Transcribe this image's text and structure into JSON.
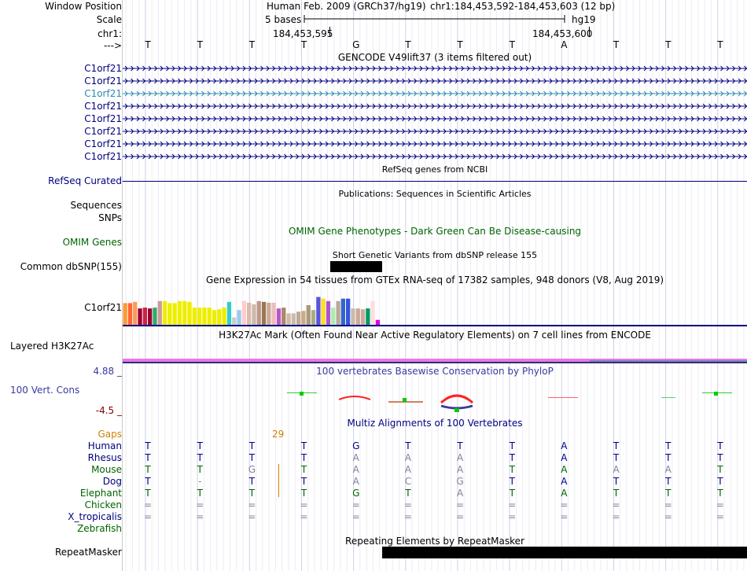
{
  "labels": {
    "window_position": "Window Position",
    "scale": "Scale",
    "chrom": "chr1:",
    "arrow": "--->",
    "gencode_items": [
      "C1orf21",
      "C1orf21",
      "C1orf21",
      "C1orf21",
      "C1orf21",
      "C1orf21",
      "C1orf21",
      "C1orf21"
    ],
    "refseq": "RefSeq Curated",
    "sequences": "Sequences",
    "snps": "SNPs",
    "omim": "OMIM Genes",
    "dbsnp": "Common dbSNP(155)",
    "gtex_gene": "C1orf21",
    "h3k27ac": "Layered H3K27Ac",
    "phylop_max": "4.88 _",
    "phylop_label": "100 Vert. Cons",
    "phylop_min": "-4.5 _",
    "gaps": "Gaps",
    "species": [
      "Human",
      "Rhesus",
      "Mouse",
      "Dog",
      "Elephant",
      "Chicken",
      "X_tropicalis",
      "Zebrafish"
    ],
    "repeatmasker": "RepeatMasker"
  },
  "header": {
    "assembly": "Human Feb. 2009 (GRCh37/hg19)",
    "position": "chr1:184,453,592-184,453,603 (12 bp)",
    "scale_text": "5 bases",
    "db": "hg19",
    "coord1": "184,453,595",
    "coord2": "184,453,600"
  },
  "sequence": [
    "T",
    "T",
    "T",
    "T",
    "G",
    "T",
    "T",
    "T",
    "A",
    "T",
    "T",
    "T"
  ],
  "track_titles": {
    "gencode": "GENCODE V49lift37 (3 items filtered out)",
    "refseq": "RefSeq genes from NCBI",
    "publications": "Publications: Sequences in Scientific Articles",
    "omim": "OMIM Gene Phenotypes - Dark Green Can Be Disease-causing",
    "dbsnp": "Short Genetic Variants from dbSNP release 155",
    "gtex": "Gene Expression in 54 tissues from GTEx RNA-seq of 17382 samples, 948 donors (V8, Aug 2019)",
    "h3k27ac": "H3K27Ac Mark (Often Found Near Active Regulatory Elements) on 7 cell lines from ENCODE",
    "phylop": "100 vertebrates Basewise Conservation by PhyloP",
    "multiz": "Multiz Alignments of 100 Vertebrates",
    "repeatmasker": "Repeating Elements by RepeatMasker"
  },
  "gaps_value": "29",
  "alignment": {
    "Human": [
      "T",
      "T",
      "T",
      "T",
      "G",
      "T",
      "T",
      "T",
      "A",
      "T",
      "T",
      "T"
    ],
    "Rhesus": [
      "T",
      "T",
      "T",
      "T",
      "A",
      "A",
      "A",
      "T",
      "A",
      "T",
      "T",
      "T"
    ],
    "Mouse": [
      "T",
      "T",
      "G",
      "T",
      "A",
      "A",
      "A",
      "T",
      "A",
      "A",
      "A",
      "T"
    ],
    "Dog": [
      "T",
      "-",
      "T",
      "T",
      "A",
      "C",
      "G",
      "T",
      "A",
      "T",
      "T",
      "T"
    ],
    "Elephant": [
      "T",
      "T",
      "T",
      "T",
      "G",
      "T",
      "A",
      "T",
      "A",
      "T",
      "T",
      "T"
    ],
    "Chicken": [
      "=",
      "=",
      "=",
      "=",
      "=",
      "=",
      "=",
      "=",
      "=",
      "=",
      "=",
      "="
    ],
    "X_tropicalis": [
      "=",
      "=",
      "=",
      "=",
      "=",
      "=",
      "=",
      "=",
      "=",
      "=",
      "=",
      "="
    ],
    "Zebrafish": []
  },
  "colors": {
    "navy": "#000080",
    "gencode_highlight": "#2a8bb0",
    "omim_green": "#006400",
    "h3k27ac_pink": "#e878e8",
    "phylop_blue": "#3a3aa0",
    "gaps_orange": "#d08000"
  },
  "gtex_bars": [
    {
      "color": "#ff9933",
      "value": 0.55
    },
    {
      "color": "#ff6633",
      "value": 0.55
    },
    {
      "color": "#ff9955",
      "value": 0.58
    },
    {
      "color": "#990033",
      "value": 0.42
    },
    {
      "color": "#cc2244",
      "value": 0.44
    },
    {
      "color": "#990033",
      "value": 0.42
    },
    {
      "color": "#33aa66",
      "value": 0.44
    },
    {
      "color": "#cc9999",
      "value": 0.6
    },
    {
      "color": "#eeee00",
      "value": 0.6
    },
    {
      "color": "#eeee00",
      "value": 0.55
    },
    {
      "color": "#eeee00",
      "value": 0.55
    },
    {
      "color": "#eeee00",
      "value": 0.6
    },
    {
      "color": "#eeee00",
      "value": 0.6
    },
    {
      "color": "#eeee00",
      "value": 0.58
    },
    {
      "color": "#eeee00",
      "value": 0.44
    },
    {
      "color": "#eeee00",
      "value": 0.44
    },
    {
      "color": "#eeee00",
      "value": 0.44
    },
    {
      "color": "#eeee00",
      "value": 0.44
    },
    {
      "color": "#eeee00",
      "value": 0.38
    },
    {
      "color": "#eeee00",
      "value": 0.4
    },
    {
      "color": "#eeee00",
      "value": 0.44
    },
    {
      "color": "#33cccc",
      "value": 0.58
    },
    {
      "color": "#cccccc",
      "value": 0.2
    },
    {
      "color": "#99ccee",
      "value": 0.38
    },
    {
      "color": "#ffcccc",
      "value": 0.6
    },
    {
      "color": "#ddbbaa",
      "value": 0.56
    },
    {
      "color": "#ccbbaa",
      "value": 0.52
    },
    {
      "color": "#bb9988",
      "value": 0.6
    },
    {
      "color": "#997755",
      "value": 0.58
    },
    {
      "color": "#ccaa99",
      "value": 0.56
    },
    {
      "color": "#eebbbb",
      "value": 0.56
    },
    {
      "color": "#bb55cc",
      "value": 0.42
    },
    {
      "color": "#aa8866",
      "value": 0.44
    },
    {
      "color": "#ccbbaa",
      "value": 0.3
    },
    {
      "color": "#ccbbaa",
      "value": 0.3
    },
    {
      "color": "#bbaa99",
      "value": 0.34
    },
    {
      "color": "#ccaa88",
      "value": 0.36
    },
    {
      "color": "#aa9977",
      "value": 0.5
    },
    {
      "color": "#aaaa88",
      "value": 0.38
    },
    {
      "color": "#5555dd",
      "value": 0.7
    },
    {
      "color": "#ffdd22",
      "value": 0.66
    },
    {
      "color": "#aa55cc",
      "value": 0.6
    },
    {
      "color": "#aaeeaa",
      "value": 0.44
    },
    {
      "color": "#bbaa99",
      "value": 0.6
    },
    {
      "color": "#3366cc",
      "value": 0.66
    },
    {
      "color": "#3355dd",
      "value": 0.66
    },
    {
      "color": "#ccbbaa",
      "value": 0.42
    },
    {
      "color": "#ccaa99",
      "value": 0.42
    },
    {
      "color": "#ccaa99",
      "value": 0.4
    },
    {
      "color": "#009966",
      "value": 0.42
    },
    {
      "color": "#ffdddd",
      "value": 0.6
    },
    {
      "color": "#dd00dd",
      "value": 0.14
    }
  ]
}
